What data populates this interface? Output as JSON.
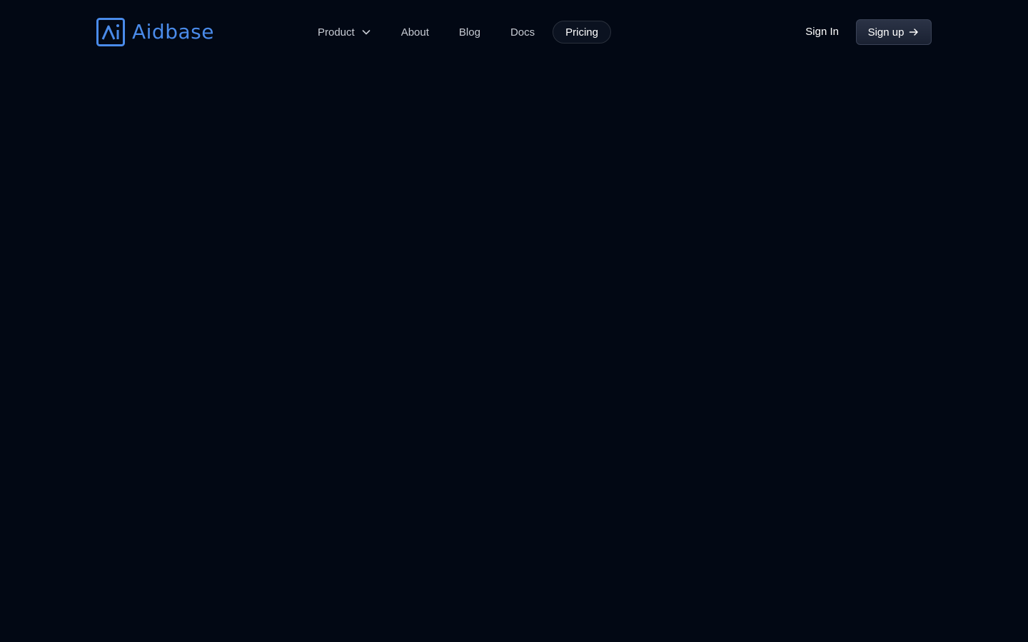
{
  "brand": {
    "name": "Aidbase",
    "color": "#4A8BEA",
    "icon": "aidbase-logo-icon"
  },
  "nav": {
    "items": [
      {
        "label": "Product",
        "has_dropdown": true,
        "icon": "chevron-down-icon"
      },
      {
        "label": "About"
      },
      {
        "label": "Blog"
      },
      {
        "label": "Docs"
      },
      {
        "label": "Pricing",
        "active": true
      }
    ]
  },
  "auth": {
    "signin_label": "Sign In",
    "signup_label": "Sign up",
    "signup_icon": "arrow-right-icon"
  },
  "colors": {
    "background": "#020814",
    "nav_text": "#C7CBD3",
    "active_pill_bg": "#0B1220",
    "signup_bg": "#1F2638"
  }
}
